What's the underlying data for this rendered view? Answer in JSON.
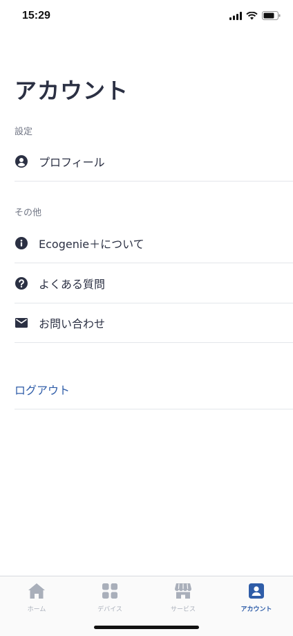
{
  "status_bar": {
    "time": "15:29"
  },
  "header": {
    "title": "アカウント"
  },
  "sections": {
    "settings": {
      "label": "設定",
      "items": [
        {
          "label": "プロフィール",
          "icon": "user-circle-icon"
        }
      ]
    },
    "other": {
      "label": "その他",
      "items": [
        {
          "label": "Ecogenie＋について",
          "icon": "info-icon"
        },
        {
          "label": "よくある質問",
          "icon": "question-icon"
        },
        {
          "label": "お問い合わせ",
          "icon": "mail-icon"
        }
      ]
    }
  },
  "logout": {
    "label": "ログアウト"
  },
  "tab_bar": {
    "tabs": [
      {
        "label": "ホーム",
        "icon": "home-icon",
        "active": false
      },
      {
        "label": "デバイス",
        "icon": "devices-icon",
        "active": false
      },
      {
        "label": "サービス",
        "icon": "store-icon",
        "active": false
      },
      {
        "label": "アカウント",
        "icon": "account-icon",
        "active": true
      }
    ]
  },
  "colors": {
    "text": "#2b3043",
    "accent": "#2f5da8",
    "inactive": "#a9afba",
    "divider": "#e3e6ea"
  }
}
